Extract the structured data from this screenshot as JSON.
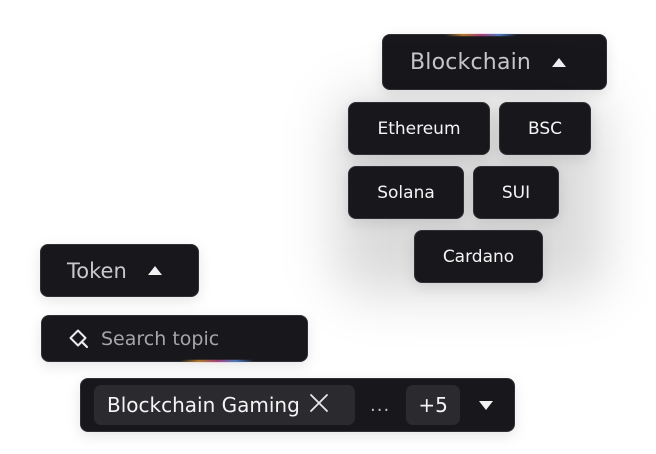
{
  "blockchain_dropdown": {
    "label": "Blockchain",
    "options": [
      "Ethereum",
      "BSC",
      "Solana",
      "SUI",
      "Cardano"
    ]
  },
  "token_dropdown": {
    "label": "Token"
  },
  "search": {
    "placeholder": "Search topic"
  },
  "multiselect": {
    "selected": [
      "Blockchain Gaming"
    ],
    "overflow_indicator": "...",
    "more_count": "+5"
  },
  "icons": {
    "expand": "caret-up-icon",
    "collapse": "caret-down-icon",
    "search": "search-icon",
    "remove": "close-icon"
  },
  "colors": {
    "surface": "#18181c",
    "chip": "#2a2a2f",
    "text": "#f4f4f4",
    "muted_text": "#c9c9cc"
  }
}
